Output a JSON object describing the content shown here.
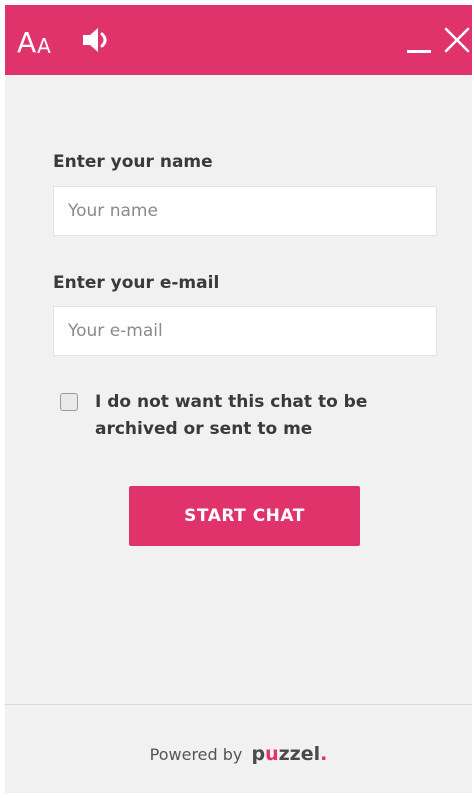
{
  "header": {
    "font_size_big": "A",
    "font_size_small": "A",
    "sound_icon": "speaker-icon",
    "minimize_icon": "minimize-icon",
    "close_icon": "close-icon"
  },
  "form": {
    "name_label": "Enter your name",
    "name_placeholder": "Your name",
    "name_value": "",
    "email_label": "Enter your e-mail",
    "email_placeholder": "Your e-mail",
    "email_value": "",
    "archive_checkbox_label": "I do not want this chat to be archived or sent to me",
    "archive_checked": false,
    "start_button_label": "START CHAT"
  },
  "footer": {
    "powered_by": "Powered by",
    "brand_p": "p",
    "brand_u": "u",
    "brand_rest": "zzel",
    "brand_dot": "."
  },
  "colors": {
    "accent": "#e0336b",
    "background": "#f1f1f1",
    "text": "#3a3a3a"
  }
}
